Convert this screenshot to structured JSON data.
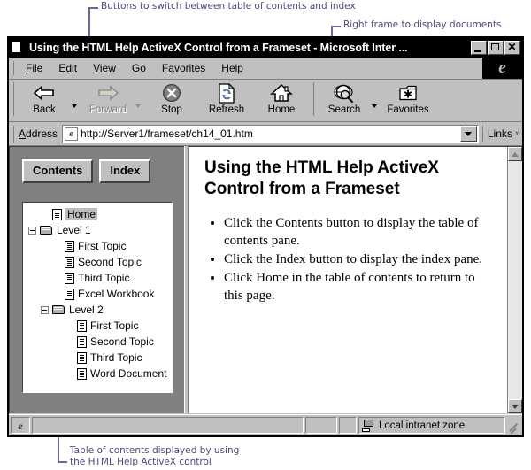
{
  "annotations": {
    "top_left": "Buttons to switch between table of contents and index",
    "top_right": "Right frame to display documents",
    "bottom": "Table of contents displayed by using\nthe HTML Help ActiveX control",
    "color": "#4a4a7c",
    "line_color": "#6a6a99"
  },
  "window": {
    "title": "Using the HTML Help ActiveX Control from a Frameset - Microsoft Inter ...",
    "title_icon": "document-icon",
    "controls": {
      "minimize": "minimize-button",
      "maximize": "maximize-button",
      "close": "close-button",
      "close_glyph": "✕"
    }
  },
  "menubar": {
    "items": [
      {
        "label": "File",
        "accel": "F"
      },
      {
        "label": "Edit",
        "accel": "E"
      },
      {
        "label": "View",
        "accel": "V"
      },
      {
        "label": "Go",
        "accel": "G"
      },
      {
        "label": "Favorites",
        "accel": "a"
      },
      {
        "label": "Help",
        "accel": "H"
      }
    ],
    "brand_logo": "internet-explorer-logo"
  },
  "toolbar": {
    "buttons": [
      {
        "label": "Back",
        "icon": "back-arrow-icon",
        "enabled": true,
        "has_dropdown": true
      },
      {
        "label": "Forward",
        "icon": "forward-arrow-icon",
        "enabled": false,
        "has_dropdown": true
      },
      {
        "label": "Stop",
        "icon": "stop-icon",
        "enabled": true,
        "has_dropdown": false
      },
      {
        "label": "Refresh",
        "icon": "refresh-icon",
        "enabled": true,
        "has_dropdown": false
      },
      {
        "label": "Home",
        "icon": "home-icon",
        "enabled": true,
        "has_dropdown": false
      },
      {
        "label": "Search",
        "icon": "search-globe-icon",
        "enabled": true,
        "has_dropdown": true
      },
      {
        "label": "Favorites",
        "icon": "favorites-folder-icon",
        "enabled": true,
        "has_dropdown": false
      }
    ]
  },
  "address_bar": {
    "label": "Address",
    "value": "http://Server1/frameset/ch14_01.htm",
    "icon": "page-icon",
    "dropdown": "address-history-dropdown",
    "links_label": "Links",
    "links_chevron": "»"
  },
  "left_pane": {
    "buttons": [
      {
        "label": "Contents",
        "name": "contents-button"
      },
      {
        "label": "Index",
        "name": "index-button"
      }
    ],
    "tree": [
      {
        "label": "Home",
        "icon": "page-icon",
        "indent": 1,
        "expander": false,
        "selected": true
      },
      {
        "label": "Level 1",
        "icon": "folder-icon",
        "indent": 0,
        "expander": true,
        "selected": false
      },
      {
        "label": "First Topic",
        "icon": "page-icon",
        "indent": 2,
        "expander": false,
        "selected": false
      },
      {
        "label": "Second Topic",
        "icon": "page-icon",
        "indent": 2,
        "expander": false,
        "selected": false
      },
      {
        "label": "Third Topic",
        "icon": "page-icon",
        "indent": 2,
        "expander": false,
        "selected": false
      },
      {
        "label": "Excel Workbook",
        "icon": "page-icon",
        "indent": 2,
        "expander": false,
        "selected": false
      },
      {
        "label": "Level 2",
        "icon": "folder-icon",
        "indent": 1,
        "expander": true,
        "selected": false
      },
      {
        "label": "First Topic",
        "icon": "page-icon",
        "indent": 3,
        "expander": false,
        "selected": false
      },
      {
        "label": "Second Topic",
        "icon": "page-icon",
        "indent": 3,
        "expander": false,
        "selected": false
      },
      {
        "label": "Third Topic",
        "icon": "page-icon",
        "indent": 3,
        "expander": false,
        "selected": false
      },
      {
        "label": "Word Document",
        "icon": "page-icon",
        "indent": 3,
        "expander": false,
        "selected": false
      }
    ]
  },
  "document": {
    "title": "Using the HTML Help ActiveX Control from a Frameset",
    "bullets": [
      "Click the Contents button to display the table of contents pane.",
      "Click the Index button to display the index pane.",
      "Click Home in the table of contents to return to this page."
    ]
  },
  "status_bar": {
    "message": "",
    "zone": "Local intranet zone",
    "zone_icon": "network-computer-icon",
    "page_icon": "page-icon"
  }
}
